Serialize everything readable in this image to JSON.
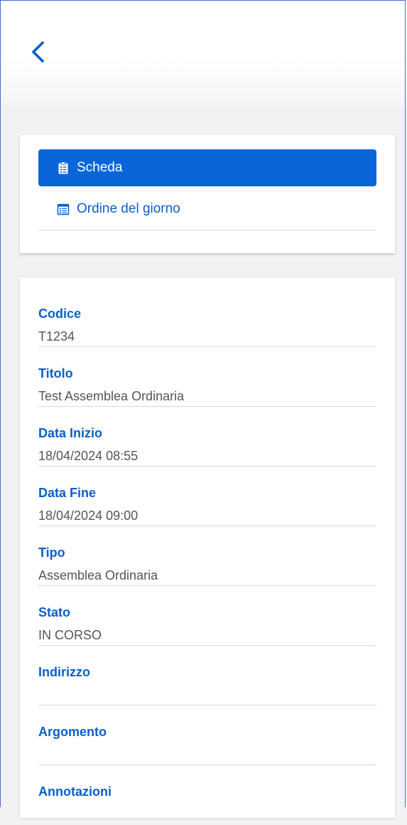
{
  "header": {
    "back_icon": "chevron-left-icon"
  },
  "tabs": [
    {
      "label": "Scheda",
      "icon": "clipboard-icon",
      "active": true
    },
    {
      "label": "Ordine del giorno",
      "icon": "calendar-list-icon",
      "active": false
    }
  ],
  "details": {
    "codice": {
      "label": "Codice",
      "value": "T1234"
    },
    "titolo": {
      "label": "Titolo",
      "value": "Test Assemblea Ordinaria"
    },
    "data_inizio": {
      "label": "Data Inizio",
      "value": "18/04/2024 08:55"
    },
    "data_fine": {
      "label": "Data Fine",
      "value": "18/04/2024 09:00"
    },
    "tipo": {
      "label": "Tipo",
      "value": "Assemblea Ordinaria"
    },
    "stato": {
      "label": "Stato",
      "value": "IN CORSO"
    },
    "indirizzo": {
      "label": "Indirizzo",
      "value": ""
    },
    "argomento": {
      "label": "Argomento",
      "value": ""
    },
    "annotazioni": {
      "label": "Annotazioni",
      "value": ""
    }
  },
  "colors": {
    "accent": "#0a66d8",
    "label_text": "#0a5fc9",
    "value_text": "#555555",
    "frame_border": "#3f72c8"
  }
}
